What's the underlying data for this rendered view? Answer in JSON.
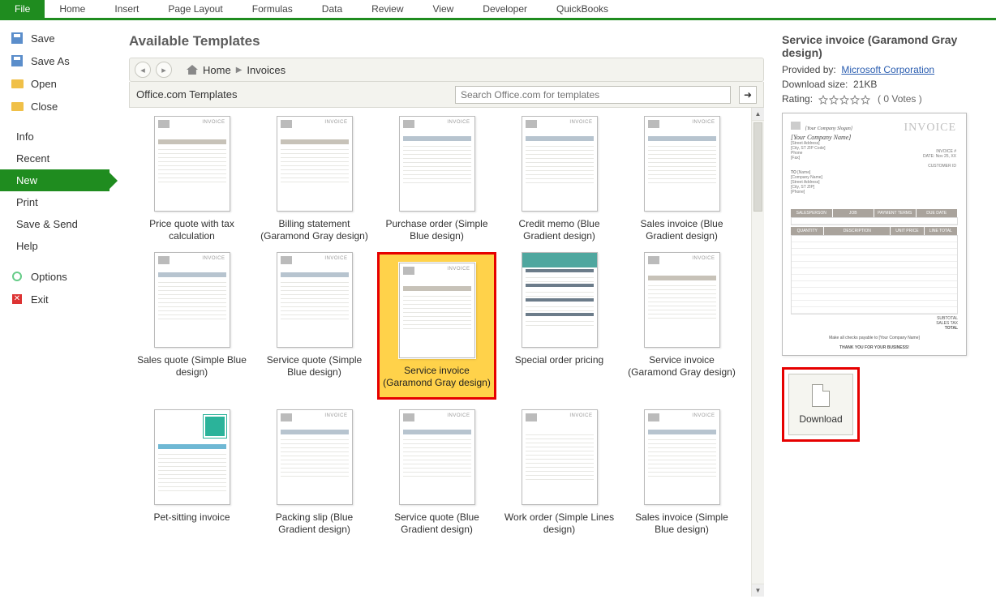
{
  "ribbon": {
    "tabs": [
      "File",
      "Home",
      "Insert",
      "Page Layout",
      "Formulas",
      "Data",
      "Review",
      "View",
      "Developer",
      "QuickBooks"
    ]
  },
  "backstage": {
    "items": [
      {
        "label": "Save",
        "icon": "disk"
      },
      {
        "label": "Save As",
        "icon": "disk"
      },
      {
        "label": "Open",
        "icon": "folder"
      },
      {
        "label": "Close",
        "icon": "folder"
      },
      {
        "label": "Info",
        "noicon": true
      },
      {
        "label": "Recent",
        "noicon": true
      },
      {
        "label": "New",
        "noicon": true,
        "selected": true
      },
      {
        "label": "Print",
        "noicon": true
      },
      {
        "label": "Save & Send",
        "noicon": true
      },
      {
        "label": "Help",
        "noicon": true
      },
      {
        "label": "Options",
        "icon": "gear"
      },
      {
        "label": "Exit",
        "icon": "x"
      }
    ]
  },
  "center": {
    "heading": "Available Templates",
    "breadcrumb": {
      "home": "Home",
      "current": "Invoices"
    },
    "toolbar": {
      "label": "Office.com Templates",
      "search_placeholder": "Search Office.com for templates"
    },
    "templates": [
      {
        "label": "Price quote with tax calculation",
        "style": "gray"
      },
      {
        "label": "Billing statement (Garamond Gray design)",
        "style": "gray"
      },
      {
        "label": "Purchase order (Simple Blue design)",
        "style": "blue"
      },
      {
        "label": "Credit memo (Blue Gradient design)",
        "style": "blue"
      },
      {
        "label": "Sales invoice (Blue Gradient design)",
        "style": "blue"
      },
      {
        "label": "Sales quote (Simple Blue design)",
        "style": "blue"
      },
      {
        "label": "Service quote (Simple Blue design)",
        "style": "blue"
      },
      {
        "label": "Service invoice (Garamond Gray design)",
        "style": "gray",
        "selected": true
      },
      {
        "label": "Special order pricing",
        "style": "teal"
      },
      {
        "label": "Service invoice (Garamond Gray design)",
        "style": "gray"
      },
      {
        "label": "Pet-sitting invoice",
        "style": "pet"
      },
      {
        "label": "Packing slip (Blue Gradient design)",
        "style": "blue"
      },
      {
        "label": "Service quote (Blue Gradient design)",
        "style": "blue"
      },
      {
        "label": "Work order (Simple Lines design)",
        "style": "plain"
      },
      {
        "label": "Sales invoice (Simple Blue design)",
        "style": "blue"
      }
    ]
  },
  "right": {
    "title": "Service invoice (Garamond Gray design)",
    "provided_by_label": "Provided by:",
    "provider": "Microsoft Corporation",
    "download_size_label": "Download size:",
    "download_size": "21KB",
    "rating_label": "Rating:",
    "votes": "( 0 Votes )",
    "download_label": "Download",
    "preview": {
      "invoice_word": "INVOICE",
      "placeholder": "[Your Company Slogan]",
      "company": "[Your Company Name]",
      "thanks": "THANK YOU FOR YOUR BUSINESS!",
      "cols1": [
        "SALESPERSON",
        "JOB",
        "PAYMENT TERMS",
        "DUE DATE"
      ],
      "cols2": [
        "QUANTITY",
        "DESCRIPTION",
        "UNIT PRICE",
        "LINE TOTAL"
      ],
      "totals": [
        "SUBTOTAL",
        "SALES TAX",
        "TOTAL"
      ],
      "make_checks": "Make all checks payable to [Your Company Name]"
    }
  }
}
